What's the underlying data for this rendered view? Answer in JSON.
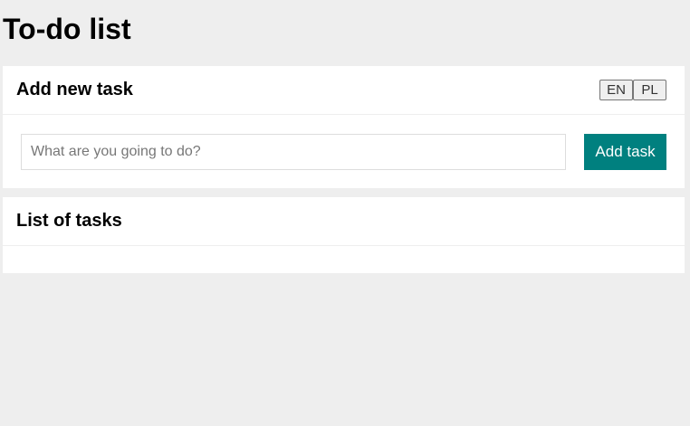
{
  "page": {
    "title": "To-do list"
  },
  "add_panel": {
    "title": "Add new task",
    "languages": [
      "EN",
      "PL"
    ],
    "input": {
      "placeholder": "What are you going to do?",
      "value": ""
    },
    "submit_label": "Add task"
  },
  "list_panel": {
    "title": "List of tasks",
    "tasks": []
  },
  "colors": {
    "accent": "#00807f",
    "background": "#eeeeee",
    "panel": "#ffffff"
  }
}
